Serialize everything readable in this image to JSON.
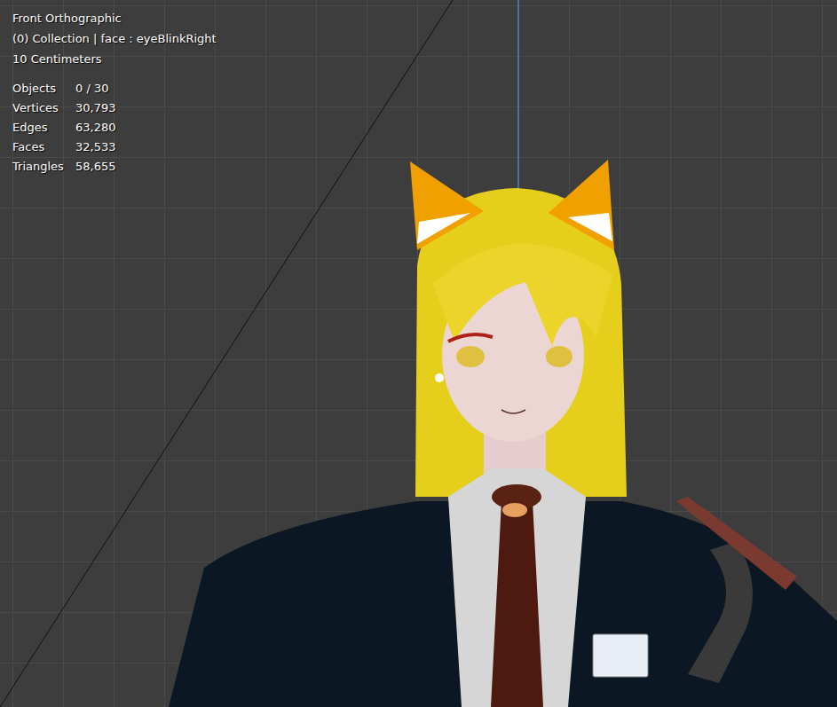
{
  "viewport": {
    "view": "Front Orthographic",
    "context": "(0) Collection | face : eyeBlinkRight",
    "scale": "10 Centimeters"
  },
  "stats": [
    {
      "label": "Objects",
      "value": "0 / 30"
    },
    {
      "label": "Vertices",
      "value": "30,793"
    },
    {
      "label": "Edges",
      "value": "63,280"
    },
    {
      "label": "Faces",
      "value": "32,533"
    },
    {
      "label": "Triangles",
      "value": "58,655"
    }
  ]
}
